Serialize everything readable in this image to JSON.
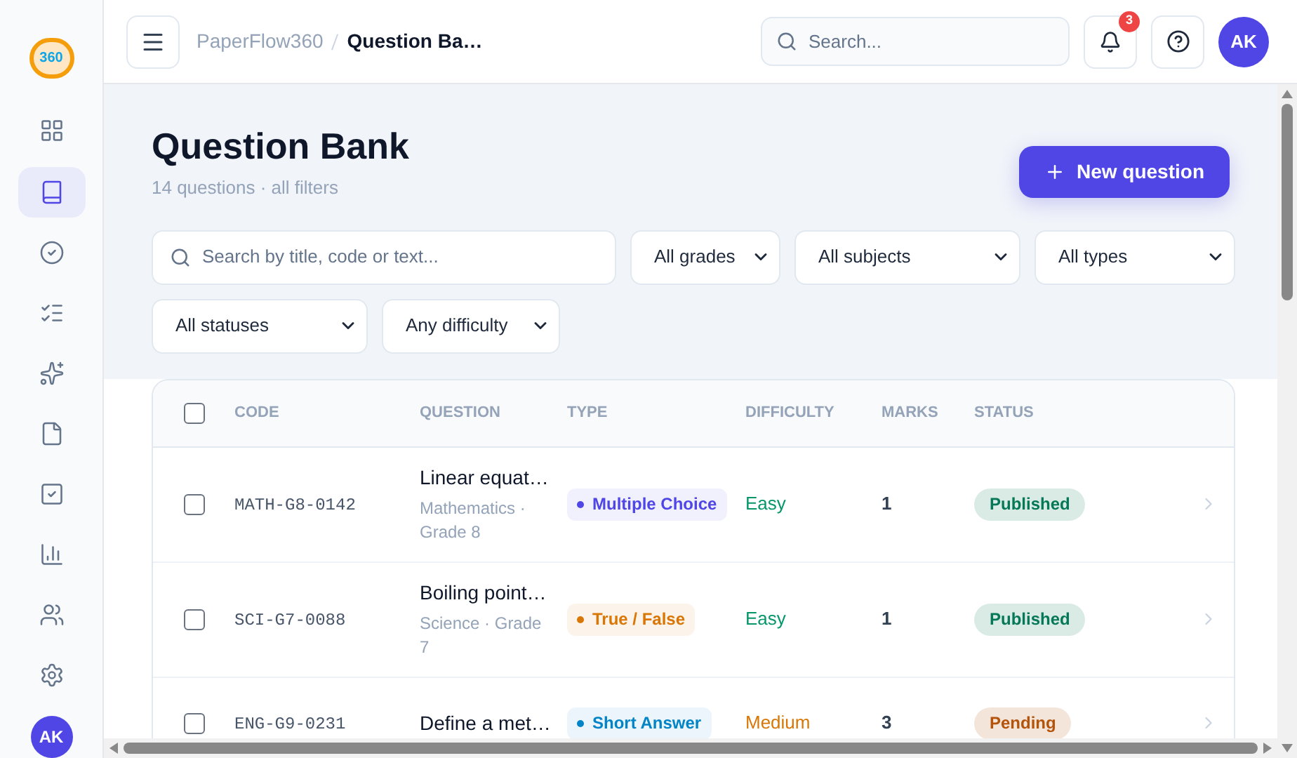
{
  "sidebar": {
    "logo": "360",
    "items": [
      {
        "kind": "grid",
        "selected": false
      },
      {
        "kind": "book",
        "selected": true
      },
      {
        "kind": "check-circle",
        "selected": false
      },
      {
        "kind": "list",
        "selected": false
      },
      {
        "kind": "sparkles",
        "selected": false
      },
      {
        "kind": "file",
        "selected": false
      },
      {
        "kind": "check-square",
        "selected": false
      },
      {
        "kind": "chart",
        "selected": false
      },
      {
        "kind": "users",
        "selected": false
      },
      {
        "kind": "settings",
        "selected": false
      }
    ],
    "avatar": "AK"
  },
  "header": {
    "breadcrumb": [
      "PaperFlow360",
      "Question Ba…"
    ],
    "search": {
      "placeholder": "Search..."
    },
    "notifications": "3",
    "avatar": "AK"
  },
  "page": {
    "title": "Question Bank",
    "subtitle": "14 questions · all filters",
    "new_button": "New question"
  },
  "filters": {
    "search": {
      "placeholder": "Search by title, code or text..."
    },
    "selects": [
      "All grades",
      "All subjects",
      "All types",
      "All statuses",
      "Any difficulty"
    ]
  },
  "table": {
    "columns": [
      "CODE",
      "QUESTION",
      "TYPE",
      "DIFFICULTY",
      "MARKS",
      "STATUS"
    ],
    "all_checked": false,
    "rows": [
      {
        "checked": false,
        "code": "MATH-G8-0142",
        "title": "Linear equat…",
        "meta": "Mathematics · Grade 8",
        "type": {
          "label": "Multiple Choice",
          "color": "#4f46e5"
        },
        "difficulty": {
          "label": "Easy",
          "color": "#059669"
        },
        "marks": "1",
        "status": {
          "label": "Published",
          "color": "#047857"
        }
      },
      {
        "checked": false,
        "code": "SCI-G7-0088",
        "title": "Boiling point…",
        "meta": "Science · Grade 7",
        "type": {
          "label": "True / False",
          "color": "#d97706"
        },
        "difficulty": {
          "label": "Easy",
          "color": "#059669"
        },
        "marks": "1",
        "status": {
          "label": "Published",
          "color": "#047857"
        }
      },
      {
        "checked": false,
        "code": "ENG-G9-0231",
        "title": "Define a met…",
        "type": {
          "label": "Short Answer",
          "color": "#0284c7"
        },
        "difficulty": {
          "label": "Medium",
          "color": "#d97706"
        },
        "marks": "3",
        "status": {
          "label": "Pending",
          "color": "#b45309"
        }
      }
    ]
  }
}
